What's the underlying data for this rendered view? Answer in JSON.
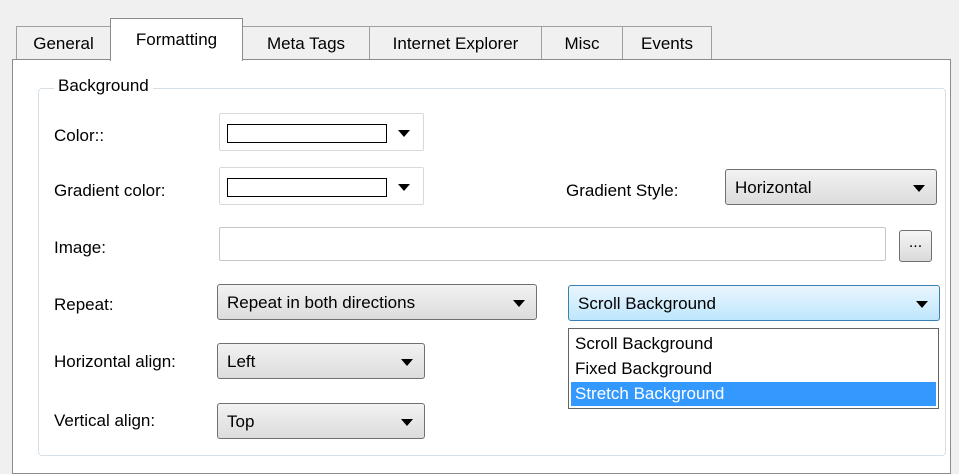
{
  "tabs": [
    {
      "label": "General"
    },
    {
      "label": "Formatting"
    },
    {
      "label": "Meta Tags"
    },
    {
      "label": "Internet Explorer"
    },
    {
      "label": "Misc"
    },
    {
      "label": "Events"
    }
  ],
  "active_tab": "Formatting",
  "background": {
    "title": "Background",
    "color_label": "Color::",
    "gradient_color_label": "Gradient color:",
    "gradient_style_label": "Gradient Style:",
    "gradient_style_value": "Horizontal",
    "image_label": "Image:",
    "image_value": "",
    "browse_label": "...",
    "repeat_label": "Repeat:",
    "repeat_value": "Repeat in both directions",
    "attachment_value": "Scroll Background",
    "attachment_options": [
      "Scroll Background",
      "Fixed Background",
      "Stretch Background"
    ],
    "attachment_highlighted": "Stretch Background",
    "horizontal_align_label": "Horizontal align:",
    "horizontal_align_value": "Left",
    "vertical_align_label": "Vertical align:",
    "vertical_align_value": "Top"
  },
  "colors": {
    "highlight": "#3399ff",
    "window_bg": "#f0f0f0",
    "panel_bg": "#ffffff"
  }
}
